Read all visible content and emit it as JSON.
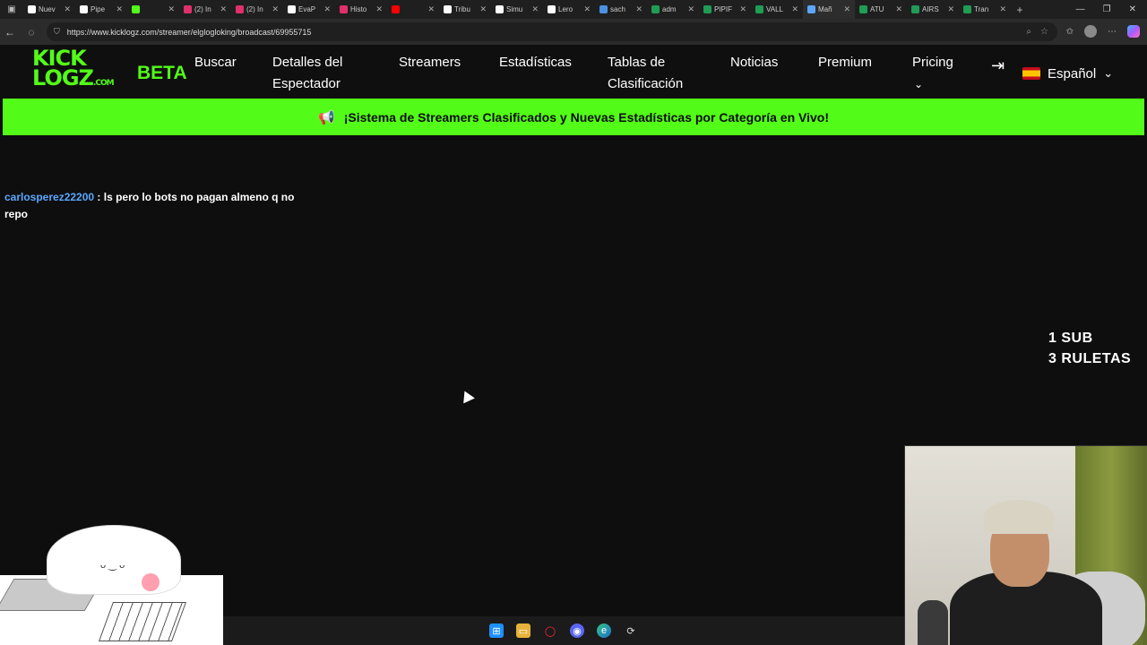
{
  "browser": {
    "tabs": [
      {
        "label": "Nuev",
        "icon": "page-icon",
        "color": "#ffffff"
      },
      {
        "label": "Pipe",
        "icon": "x-icon",
        "color": "#ffffff"
      },
      {
        "label": "",
        "icon": "kick-icon",
        "color": "#53fc18"
      },
      {
        "label": "(2) In",
        "icon": "instagram-icon",
        "color": "#e1306c"
      },
      {
        "label": "(2) In",
        "icon": "instagram-icon",
        "color": "#e1306c"
      },
      {
        "label": "EvaP",
        "icon": "x-icon",
        "color": "#ffffff"
      },
      {
        "label": "Histo",
        "icon": "instagram-icon",
        "color": "#e1306c"
      },
      {
        "label": "",
        "icon": "youtube-icon",
        "color": "#ff0000"
      },
      {
        "label": "Tribu",
        "icon": "x-icon",
        "color": "#ffffff"
      },
      {
        "label": "Simu",
        "icon": "page-icon",
        "color": "#ffffff"
      },
      {
        "label": "Lero",
        "icon": "x-icon",
        "color": "#ffffff"
      },
      {
        "label": "sach",
        "icon": "edge-icon",
        "color": "#4a90e2"
      },
      {
        "label": "adm",
        "icon": "sheet-icon",
        "color": "#1f9d55"
      },
      {
        "label": "PIPIF",
        "icon": "sheet-icon",
        "color": "#1f9d55"
      },
      {
        "label": "VALL",
        "icon": "sheet-icon",
        "color": "#1f9d55"
      },
      {
        "label": "Mañ",
        "icon": "loading-icon",
        "color": "#5ba7ff",
        "active": true
      },
      {
        "label": "ATU",
        "icon": "sheet-icon",
        "color": "#1f9d55"
      },
      {
        "label": "AIRS",
        "icon": "sheet-icon",
        "color": "#1f9d55"
      },
      {
        "label": "Tran",
        "icon": "sheet-icon",
        "color": "#1f9d55"
      }
    ],
    "url": "https://www.kicklogz.com/streamer/elglogloking/broadcast/69955715"
  },
  "site": {
    "logo_line1": "KICK",
    "logo_line2": "LOGZ",
    "logo_suffix": ".COM",
    "beta": "BETA",
    "nav": {
      "search": "Buscar",
      "viewer_details_1": "Detalles del",
      "viewer_details_2": "Espectador",
      "streamers": "Streamers",
      "stats": "Estadísticas",
      "leaderboards_1": "Tablas de",
      "leaderboards_2": "Clasificación",
      "news": "Noticias",
      "premium": "Premium",
      "pricing": "Pricing"
    },
    "language": "Español",
    "banner": "¡Sistema de Streamers Clasificados y Nuevas Estadísticas por Categoría en Vivo!"
  },
  "chat": {
    "user": "carlosperez22200",
    "separator": " : ",
    "message": "ls pero lo bots no pagan almeno q no repo"
  },
  "overlay": {
    "line1": "1 SUB",
    "line2": "3 RULETAS"
  },
  "accent_green": "#53fc18"
}
